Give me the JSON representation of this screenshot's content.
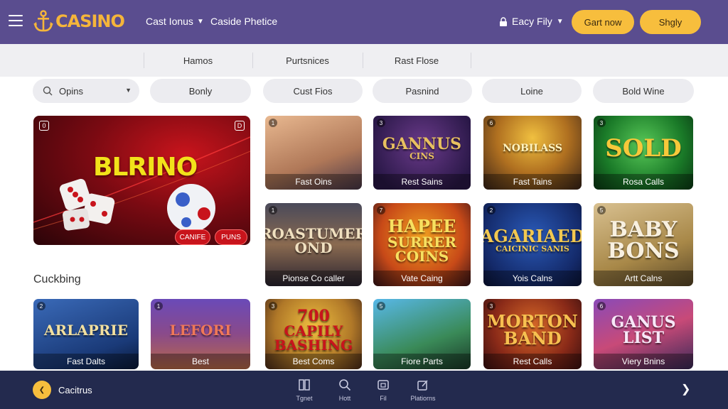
{
  "header": {
    "logo_text": "CASINO",
    "nav": [
      {
        "label": "Cast Ionus",
        "has_dropdown": true
      },
      {
        "label": "Caside Phetice",
        "has_dropdown": false
      }
    ],
    "user_menu": {
      "label": "Eacy Fily"
    },
    "cta_primary": "Gart now",
    "cta_secondary": "Shgly",
    "accent_color": "#f7be3d",
    "bar_color": "#5a4d8f"
  },
  "subnav": {
    "tabs": [
      "Hamos",
      "Purtsnices",
      "Rast Flose"
    ]
  },
  "filters": {
    "search_value": "Opins",
    "pills": [
      "Bonly",
      "Cust Fios",
      "Pasnind",
      "Loine",
      "Bold Wine"
    ]
  },
  "hero": {
    "title": "BLRINO",
    "corner_left": "0",
    "corner_right": "D",
    "buttons": [
      "CANIFE",
      "PUNS"
    ]
  },
  "section": {
    "label": "Cuckbing"
  },
  "tiles": [
    {
      "num": "1",
      "art": [
        "",
        ""
      ],
      "label": "Fast Oins"
    },
    {
      "num": "3",
      "art": [
        "GANNUS",
        "CINS"
      ],
      "label": "Rest Sains"
    },
    {
      "num": "6",
      "art": [
        "NOBILASS",
        ""
      ],
      "label": "Fast Tains"
    },
    {
      "num": "3",
      "art": [
        "SOLD",
        ""
      ],
      "label": "Rosa Calls"
    },
    {
      "num": "1",
      "art": [
        "ROASTUMER",
        "OND"
      ],
      "label": "Pionse Co caller"
    },
    {
      "num": "7",
      "art": [
        "HAPEE",
        "SURRER",
        "COINS"
      ],
      "label": "Vate Caing"
    },
    {
      "num": "2",
      "art": [
        "AGARIAED",
        "CAICINIC SANIS"
      ],
      "label": "Yois Calns"
    },
    {
      "num": "5",
      "art": [
        "BABY",
        "BONS"
      ],
      "label": "Artt Calns"
    },
    {
      "num": "2",
      "art": [
        "ARLAPRIE",
        ""
      ],
      "label": "Fast Dalts"
    },
    {
      "num": "1",
      "art": [
        "LEFORI",
        ""
      ],
      "label": "Best"
    },
    {
      "num": "3",
      "art": [
        "700",
        "CAPILY",
        "BASHING"
      ],
      "label": "Best Coms"
    },
    {
      "num": "5",
      "art": [
        "",
        ""
      ],
      "label": "Fiore Parts"
    },
    {
      "num": "3",
      "art": [
        "MORTON",
        "BAND"
      ],
      "label": "Rest Calls"
    },
    {
      "num": "6",
      "art": [
        "GANUS",
        "LIST"
      ],
      "label": "Viery Bnins"
    }
  ],
  "bottombar": {
    "name": "Cacitrus",
    "items": [
      {
        "icon": "book-icon",
        "label": "Tgnet"
      },
      {
        "icon": "search-icon",
        "label": "Hott"
      },
      {
        "icon": "tv-icon",
        "label": "Fil"
      },
      {
        "icon": "edit-icon",
        "label": "Platiorns"
      }
    ]
  }
}
